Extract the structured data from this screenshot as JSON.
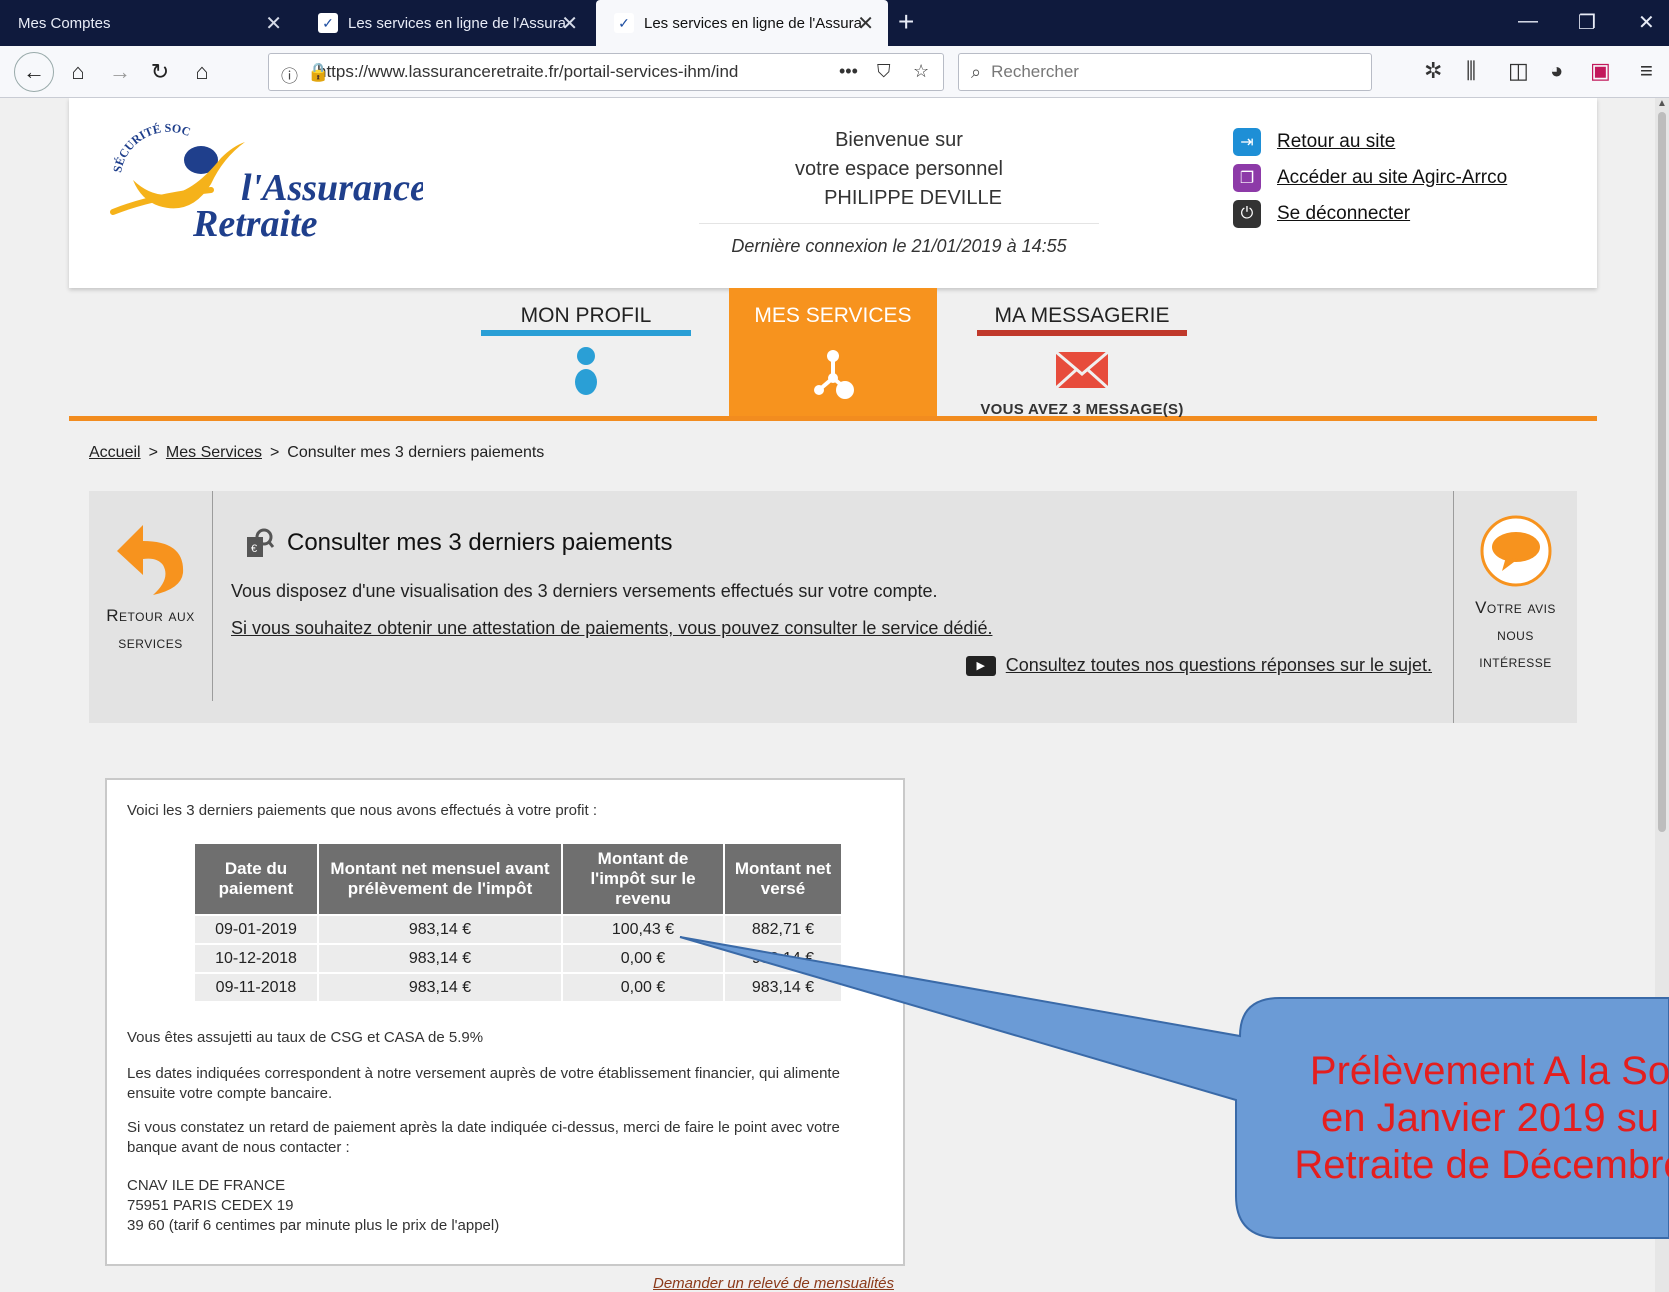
{
  "browser": {
    "tabs": [
      {
        "title": "Mes Comptes",
        "active": false
      },
      {
        "title": "Les services en ligne de l'Assura",
        "active": false
      },
      {
        "title": "Les services en ligne de l'Assura",
        "active": true
      }
    ],
    "url": "https://www.lassuranceretraite.fr/portail-services-ihm/ind",
    "search_placeholder": "Rechercher"
  },
  "header": {
    "logo_small_text": "SÉCURITÉ SOCIALE",
    "logo_line1": "l'Assurance",
    "logo_line2": "Retraite",
    "welcome_line1": "Bienvenue sur",
    "welcome_line2": "votre espace personnel",
    "user_name": "PHILIPPE DEVILLE",
    "last_login": "Dernière connexion le 21/01/2019 à 14:55",
    "links": [
      {
        "label": "Retour au site",
        "color": "#1e8fd6"
      },
      {
        "label": "Accéder au site Agirc-Arrco",
        "color": "#8d3aa8"
      },
      {
        "label": "Se déconnecter",
        "color": "#333333"
      }
    ]
  },
  "nav": {
    "profil": "MON PROFIL",
    "services": "MES SERVICES",
    "messagerie": "MA MESSAGERIE",
    "message_count": "VOUS AVEZ 3 MESSAGE(S)",
    "colors": {
      "profil": "#2a9fd6",
      "services": "#f7931e",
      "messagerie": "#c0392b"
    }
  },
  "breadcrumb": {
    "home": "Accueil",
    "services": "Mes Services",
    "current": "Consulter mes 3 derniers paiements"
  },
  "service": {
    "back_line1": "Retour aux",
    "back_line2": "services",
    "title": "Consulter mes 3 derniers paiements",
    "description": "Vous disposez d'une visualisation des 3 derniers versements effectués sur votre compte.",
    "attestation_link": "Si vous souhaitez obtenir une attestation de paiements, vous pouvez consulter le service dédié.",
    "faq_link": "Consultez toutes nos questions réponses sur le sujet.",
    "vote_line1": "Votre avis",
    "vote_line2": "nous",
    "vote_line3": "intéresse"
  },
  "payments": {
    "intro": "Voici les 3 derniers paiements que nous avons effectués à votre profit :",
    "columns": [
      "Date du paiement",
      "Montant net mensuel avant prélèvement de l'impôt",
      "Montant de l'impôt sur le revenu",
      "Montant net versé"
    ],
    "rows": [
      [
        "09-01-2019",
        "983,14 €",
        "100,43 €",
        "882,71 €"
      ],
      [
        "10-12-2018",
        "983,14 €",
        "0,00 €",
        "983,14 €"
      ],
      [
        "09-11-2018",
        "983,14 €",
        "0,00 €",
        "983,14 €"
      ]
    ],
    "csg_note": "Vous êtes assujetti au taux de CSG et CASA de 5.9%",
    "dates_note": "Les dates indiquées correspondent à notre versement auprès de votre établissement financier, qui alimente ensuite votre compte bancaire.",
    "delay_note": "Si vous constatez un retard de paiement après la date indiquée ci-dessus, merci de faire le point avec votre banque avant de nous contacter :",
    "address_line1": "CNAV ILE DE FRANCE",
    "address_line2": "75951 PARIS CEDEX 19",
    "address_line3": "39 60 (tarif 6 centimes par minute plus le prix de l'appel)",
    "releve_link": "Demander un relevé de mensualités"
  },
  "callout": {
    "line1": "Prélèvement A la So",
    "line2": "en Janvier 2019 su",
    "line3": "Retraite de Décembre",
    "fill": "#6b9bd6",
    "text_color": "#e41e1e"
  }
}
